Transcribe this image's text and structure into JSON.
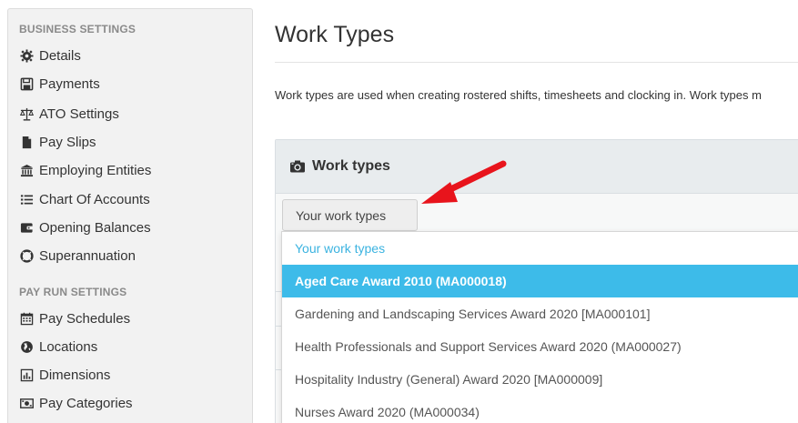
{
  "sidebar": {
    "business_title": "BUSINESS SETTINGS",
    "business_items": [
      {
        "label": "Details",
        "icon": "gear-icon"
      },
      {
        "label": "Payments",
        "icon": "save-icon"
      },
      {
        "label": "ATO Settings",
        "icon": "balance-scale-icon"
      },
      {
        "label": "Pay Slips",
        "icon": "file-icon"
      },
      {
        "label": "Employing Entities",
        "icon": "bank-icon"
      },
      {
        "label": "Chart Of Accounts",
        "icon": "list-icon"
      },
      {
        "label": "Opening Balances",
        "icon": "wallet-icon"
      },
      {
        "label": "Superannuation",
        "icon": "life-ring-icon"
      }
    ],
    "payrun_title": "PAY RUN SETTINGS",
    "payrun_items": [
      {
        "label": "Pay Schedules",
        "icon": "calendar-icon"
      },
      {
        "label": "Locations",
        "icon": "globe-icon"
      },
      {
        "label": "Dimensions",
        "icon": "bar-chart-icon"
      },
      {
        "label": "Pay Categories",
        "icon": "money-icon"
      }
    ]
  },
  "main": {
    "title": "Work Types",
    "description": "Work types are used when creating rostered shifts, timesheets and clocking in. Work types m",
    "panel_title": "Work types",
    "filter_label": "Your work types"
  },
  "dropdown": {
    "header": "Your work types",
    "selected_index": 0,
    "options": [
      "Aged Care Award 2010 (MA000018)",
      "Gardening and Landscaping Services Award 2020 [MA000101]",
      "Health Professionals and Support Services Award 2020 (MA000027)",
      "Hospitality Industry (General) Award 2020 [MA000009]",
      "Nurses Award 2020 (MA000034)"
    ]
  },
  "colors": {
    "selected_bg": "#3dbbe9",
    "header_text": "#3bb3e0",
    "arrow": "#e8141c"
  }
}
